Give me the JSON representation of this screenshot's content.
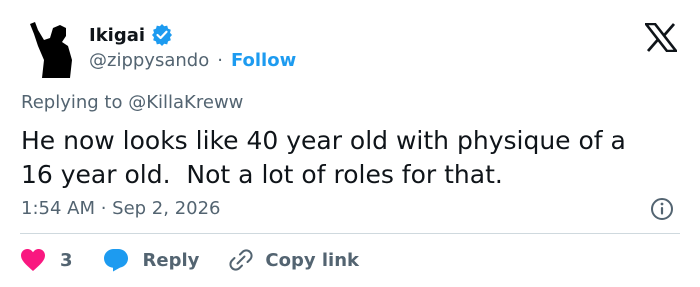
{
  "author": {
    "name": "Ikigai",
    "handle": "@zippysando",
    "separator": "·",
    "follow_label": "Follow",
    "verified": true,
    "verified_color": "#1d9bf0"
  },
  "platform_icon": "x-logo-icon",
  "reply_context": {
    "prefix": "Replying to",
    "mention": "@KillaKreww"
  },
  "tweet": {
    "text": "He now looks like 40 year old with physique of a\n16 year old.  Not a lot of roles for that.",
    "timestamp": "1:54 AM · Sep 2, 2026"
  },
  "actions": {
    "like_count": "3",
    "like_color": "#f91880",
    "reply_label": "Reply",
    "reply_color": "#1d9bf0",
    "copy_label": "Copy link"
  },
  "colors": {
    "accent": "#1d9bf0",
    "text": "#0f1419",
    "secondary": "#536471",
    "divider": "#cfd9de"
  }
}
